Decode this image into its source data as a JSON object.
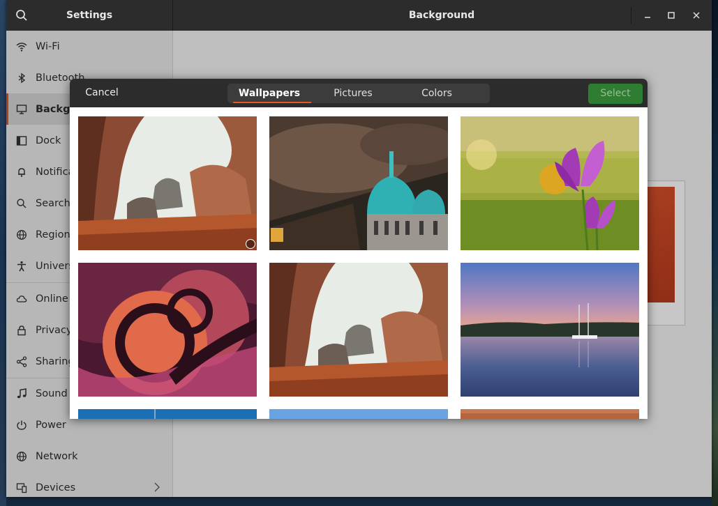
{
  "window": {
    "app_title": "Settings",
    "page_title": "Background",
    "controls": [
      "minimize-icon",
      "maximize-icon",
      "close-icon"
    ]
  },
  "sidebar": {
    "items": [
      {
        "label": "Wi-Fi",
        "icon": "wifi-icon"
      },
      {
        "label": "Bluetooth",
        "icon": "bluetooth-icon"
      },
      {
        "label": "Background",
        "icon": "display-icon",
        "active": true
      },
      {
        "label": "Dock",
        "icon": "dock-icon"
      },
      {
        "label": "Notifications",
        "icon": "bell-icon"
      },
      {
        "label": "Search",
        "icon": "search-icon"
      },
      {
        "label": "Region & Language",
        "icon": "globe-icon"
      },
      {
        "label": "Universal Access",
        "icon": "accessibility-icon"
      },
      {
        "label": "Online Accounts",
        "icon": "cloud-icon"
      },
      {
        "label": "Privacy",
        "icon": "lock-icon"
      },
      {
        "label": "Sharing",
        "icon": "share-icon"
      },
      {
        "label": "Sound",
        "icon": "music-note-icon"
      },
      {
        "label": "Power",
        "icon": "power-icon"
      },
      {
        "label": "Network",
        "icon": "network-icon"
      },
      {
        "label": "Devices",
        "icon": "devices-icon"
      }
    ]
  },
  "dialog": {
    "cancel_label": "Cancel",
    "select_label": "Select",
    "tabs": [
      {
        "label": "Wallpapers",
        "active": true
      },
      {
        "label": "Pictures"
      },
      {
        "label": "Colors"
      }
    ],
    "wallpapers": [
      {
        "name": "red-rock-arch",
        "selected": true
      },
      {
        "name": "teal-domed-cathedral"
      },
      {
        "name": "purple-crocus"
      },
      {
        "name": "abstract-swirl"
      },
      {
        "name": "red-rock-arch"
      },
      {
        "name": "lake-sunset-sailboats"
      },
      {
        "name": "blue-sky"
      },
      {
        "name": "light-blue-sky"
      },
      {
        "name": "orange-sand"
      }
    ]
  },
  "colors": {
    "accent": "#e95420",
    "select_button": "#2e7d32",
    "header": "#2c2c2c"
  }
}
